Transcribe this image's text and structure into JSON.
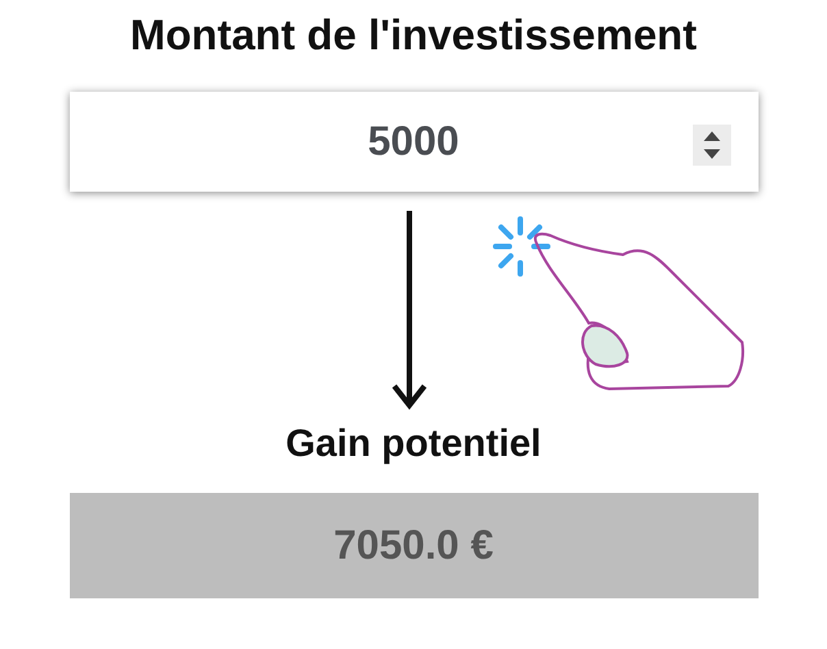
{
  "title": "Montant de l'investissement",
  "amount_field": {
    "value": "5000"
  },
  "result": {
    "label": "Gain potentiel",
    "value": "7050.0 €"
  }
}
